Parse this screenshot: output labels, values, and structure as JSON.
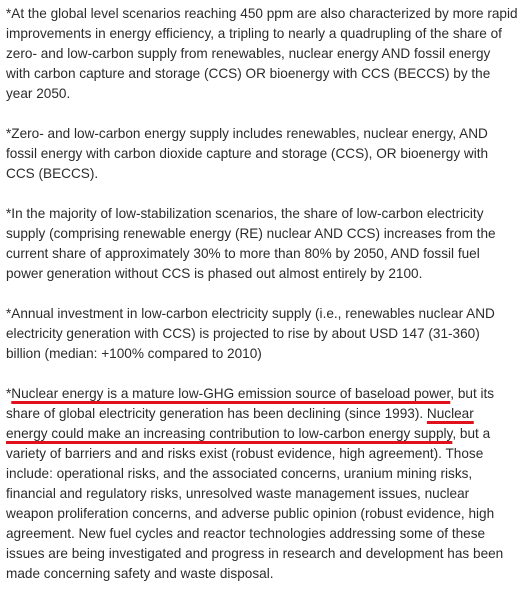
{
  "document": {
    "paragraphs": [
      {
        "segments": [
          {
            "text": "*At the global level scenarios reaching 450 ppm are also characterized by more rapid improvements in energy efficiency, a tripling to nearly a quadrupling of the share of zero- and low-carbon supply from renewables, nuclear energy AND fossil energy with carbon capture and storage (CCS) OR bioenergy with CCS (BECCS) by the year 2050.",
            "highlight": false
          }
        ]
      },
      {
        "segments": [
          {
            "text": "*Zero- and low-carbon energy supply includes renewables, nuclear energy, AND fossil energy with carbon dioxide capture and storage (CCS), OR bioenergy with CCS (BECCS).",
            "highlight": false
          }
        ]
      },
      {
        "segments": [
          {
            "text": "*In the majority of low-stabilization scenarios, the share of low-carbon electricity supply (comprising renewable energy (RE) nuclear AND CCS) increases from the current share of approximately 30% to more than 80% by 2050, AND fossil fuel power generation without CCS is phased out almost entirely by 2100.",
            "highlight": false
          }
        ]
      },
      {
        "segments": [
          {
            "text": "*Annual investment in low-carbon electricity supply (i.e., renewables nuclear AND electricity generation with CCS) is projected to rise by about USD 147 (31-360) billion (median: +100% compared to 2010)",
            "highlight": false
          }
        ]
      },
      {
        "segments": [
          {
            "text": "*",
            "highlight": false
          },
          {
            "text": "Nuclear energy is a mature low-GHG emission source of baseload power",
            "highlight": true
          },
          {
            "text": ", but its share of global electricity generation has been declining (since 1993). ",
            "highlight": false
          },
          {
            "text": "Nuclear energy could make an increasing contribution to low-carbon energy supply",
            "highlight": true
          },
          {
            "text": ", but a variety of barriers and and risks exist (robust evidence, high agreement). Those include: operational risks, and the associated concerns, uranium mining risks, financial and regulatory risks, unresolved waste management issues, nuclear weapon proliferation concerns, and adverse public opinion (robust evidence, high agreement. New fuel cycles and reactor technologies addressing some of these issues are being investigated and progress in research and development has been made concerning safety and waste disposal.",
            "highlight": false
          }
        ]
      }
    ],
    "colors": {
      "text": "#2b2b2b",
      "underline": "#e0101c",
      "background": "#ffffff"
    }
  }
}
